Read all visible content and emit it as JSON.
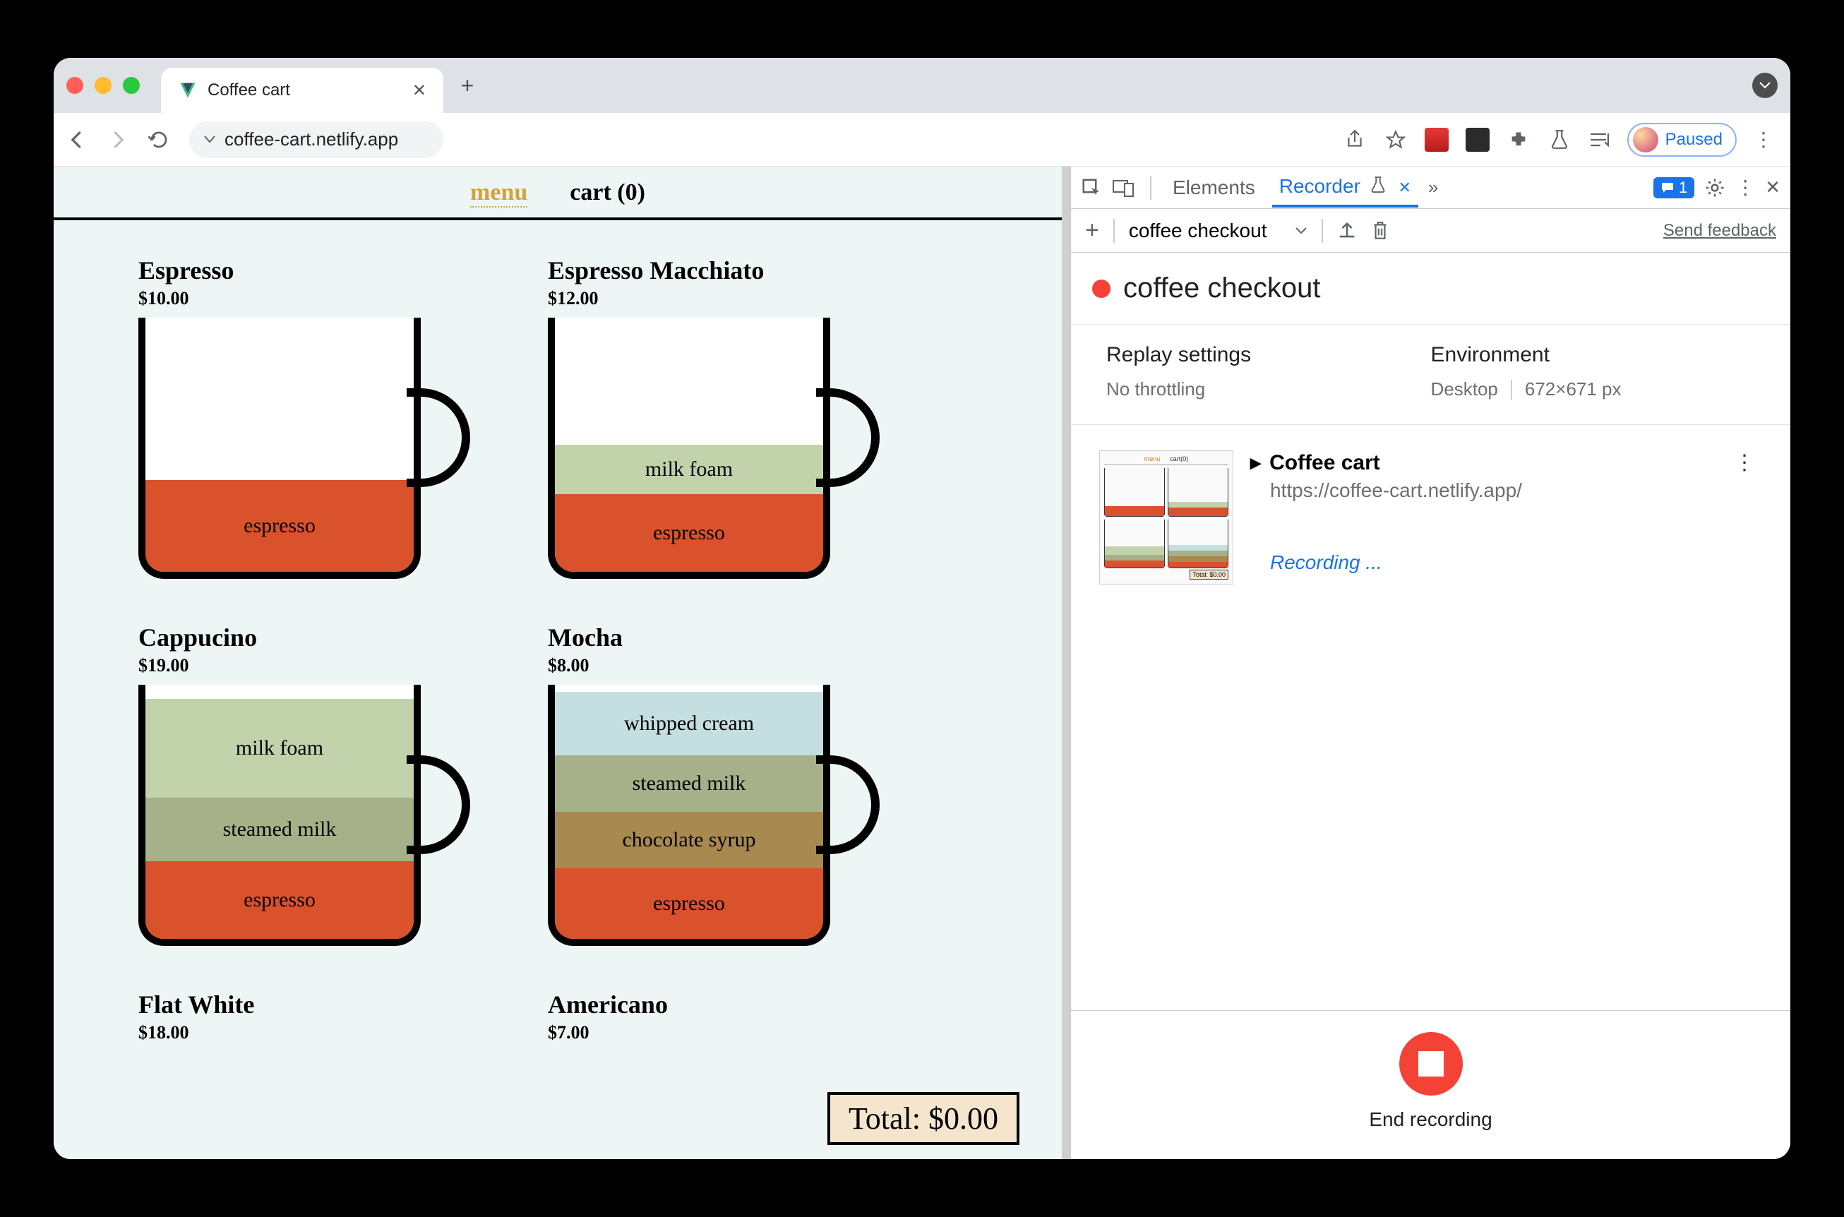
{
  "browser": {
    "tab_title": "Coffee cart",
    "url": "coffee-cart.netlify.app",
    "paused_label": "Paused",
    "extensions": [
      "ext1",
      "ext2"
    ]
  },
  "page": {
    "nav": {
      "menu": "menu",
      "cart": "cart (0)"
    },
    "products": [
      {
        "name": "Espresso",
        "price": "$10.00",
        "layers": [
          {
            "label": "espresso",
            "cls": "l-espresso",
            "h": 130
          }
        ]
      },
      {
        "name": "Espresso Macchiato",
        "price": "$12.00",
        "layers": [
          {
            "label": "milk foam",
            "cls": "l-milkfoam",
            "h": 70
          },
          {
            "label": "espresso",
            "cls": "l-espresso",
            "h": 110
          }
        ]
      },
      {
        "name": "Cappucino",
        "price": "$19.00",
        "layers": [
          {
            "label": "milk foam",
            "cls": "l-milkfoam",
            "h": 140
          },
          {
            "label": "steamed milk",
            "cls": "l-steamed",
            "h": 90
          },
          {
            "label": "espresso",
            "cls": "l-espresso",
            "h": 110
          }
        ]
      },
      {
        "name": "Mocha",
        "price": "$8.00",
        "layers": [
          {
            "label": "whipped cream",
            "cls": "l-whipped",
            "h": 90
          },
          {
            "label": "steamed milk",
            "cls": "l-steamed",
            "h": 80
          },
          {
            "label": "chocolate syrup",
            "cls": "l-choco",
            "h": 80
          },
          {
            "label": "espresso",
            "cls": "l-espresso",
            "h": 100
          }
        ]
      },
      {
        "name": "Flat White",
        "price": "$18.00",
        "layers": []
      },
      {
        "name": "Americano",
        "price": "$7.00",
        "layers": []
      }
    ],
    "total_label": "Total: $0.00"
  },
  "devtools": {
    "tabs": {
      "elements": "Elements",
      "recorder": "Recorder"
    },
    "messages_count": "1",
    "recording_dropdown": "coffee checkout",
    "feedback": "Send feedback",
    "recording_name": "coffee checkout",
    "settings": {
      "replay_heading": "Replay settings",
      "replay_value": "No throttling",
      "env_heading": "Environment",
      "env_device": "Desktop",
      "env_size": "672×671 px"
    },
    "step": {
      "title": "Coffee cart",
      "url": "https://coffee-cart.netlify.app/",
      "status": "Recording ..."
    },
    "end_label": "End recording"
  }
}
